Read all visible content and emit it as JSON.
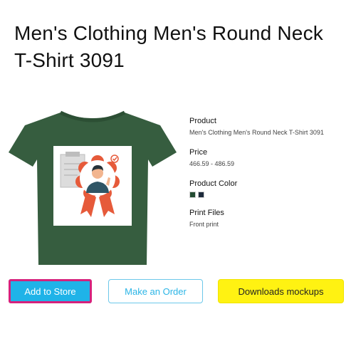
{
  "product_title": "Men's Clothing Men's Round Neck T-Shirt 3091",
  "details": {
    "product_label": "Product",
    "product_value": "Men's Clothing Men's Round Neck T-Shirt 3091",
    "price_label": "Price",
    "price_value": "466.59 - 486.59",
    "color_label": "Product Color",
    "colors": [
      "#234b32",
      "#1e2b3c"
    ],
    "print_label": "Print Files",
    "print_value": "Front print"
  },
  "mockup": {
    "shirt_color": "#365d3f",
    "design_icon": "award-medal-person-illustration"
  },
  "buttons": {
    "add_to_store": "Add to Store",
    "make_order": "Make an Order",
    "download_mockups": "Downloads mockups"
  },
  "colors": {
    "accent_blue": "#1fb3e8",
    "focus_ring": "#d6217c",
    "yellow": "#fff212"
  }
}
